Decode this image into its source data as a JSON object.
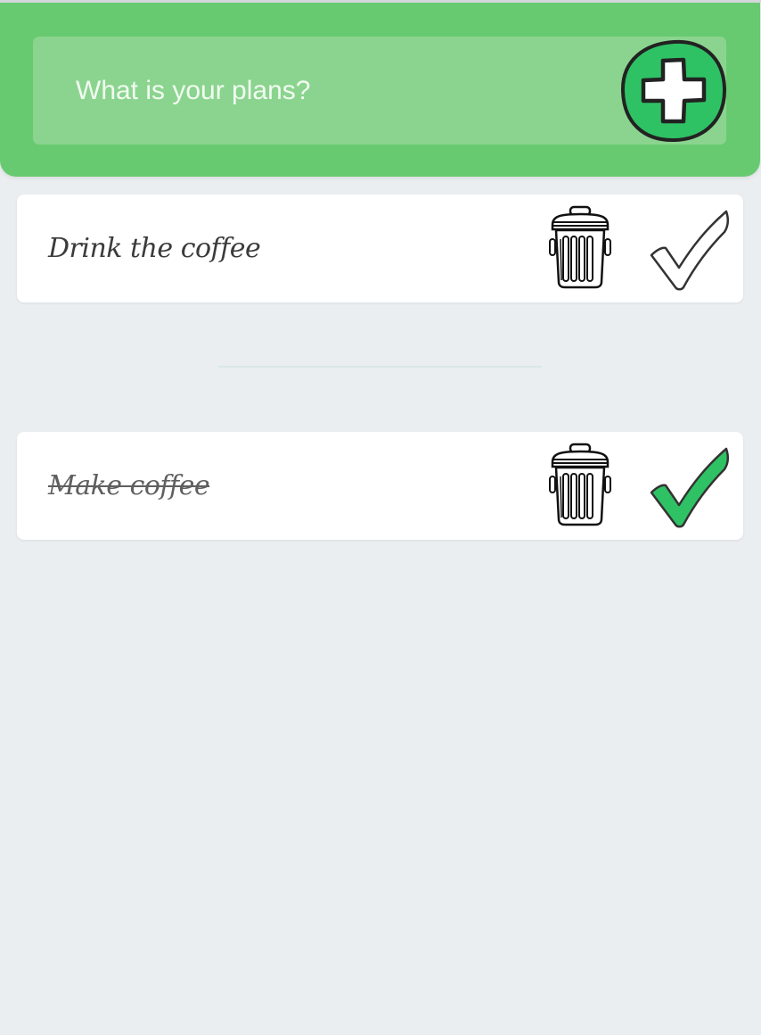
{
  "input": {
    "placeholder": "What is your plans?",
    "value": ""
  },
  "add_button": {
    "icon": "plus-icon",
    "color": "#2fc265"
  },
  "todos": [
    {
      "text": "Drink the coffee",
      "completed": false,
      "delete_icon": "trash-icon",
      "check_icon": "checkmark-outline-icon"
    }
  ],
  "completed": [
    {
      "text": "Make coffee",
      "completed": true,
      "delete_icon": "trash-icon",
      "check_icon": "checkmark-filled-icon"
    }
  ],
  "colors": {
    "header": "#68ca70",
    "input_background": "#8bd48f",
    "accent": "#2fc265",
    "page_background": "#ebeef0"
  }
}
